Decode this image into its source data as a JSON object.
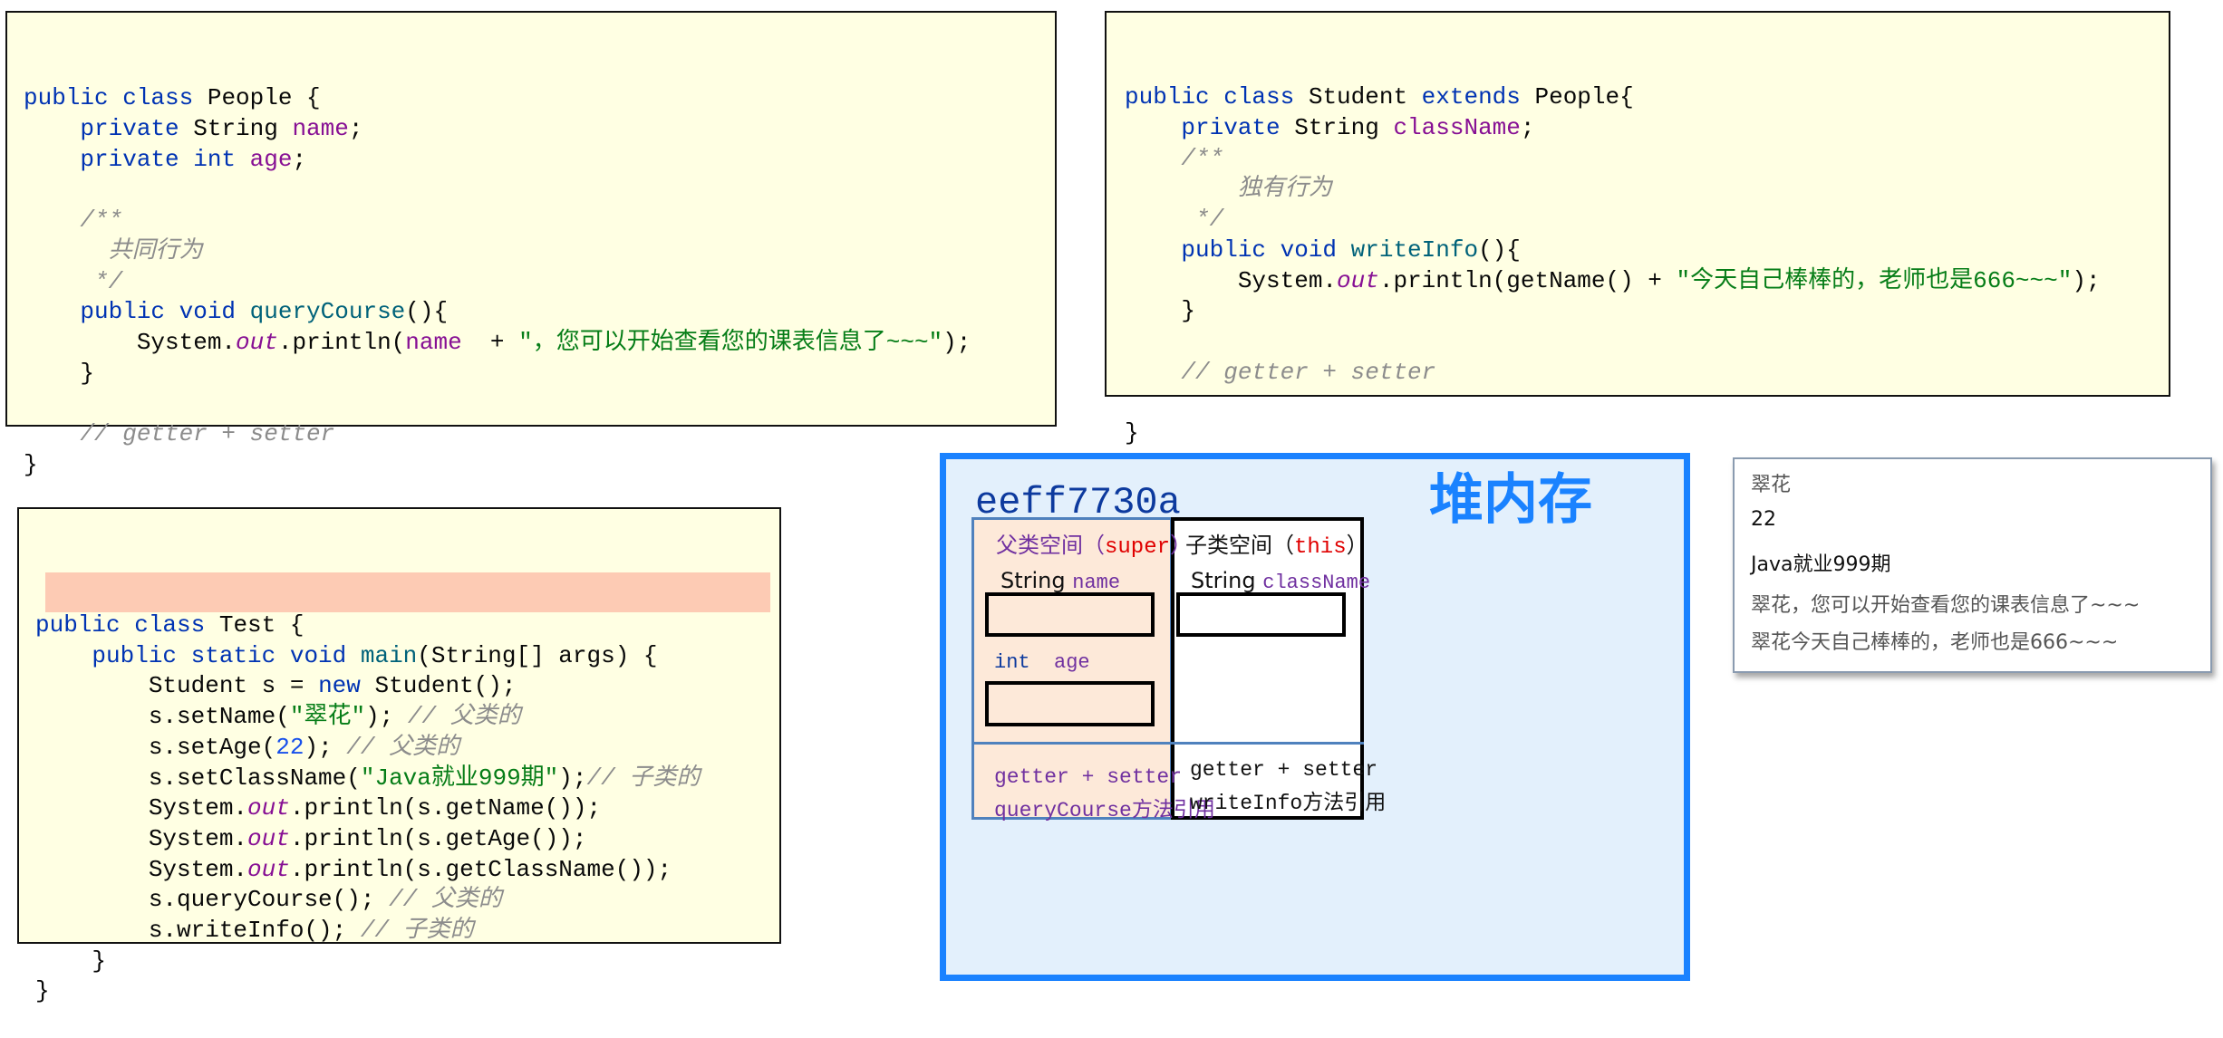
{
  "colors": {
    "code_bg": "#ffffe3",
    "keyword": "#0033b3",
    "method": "#00627a",
    "field": "#871094",
    "string": "#067d17",
    "comment": "#8c8c8c",
    "number": "#1750eb",
    "highlight": "#fdcbb4",
    "heap_border": "#1a82ff",
    "heap_bg": "#e3f0fc",
    "parent_space_bg": "#fde9d9",
    "parent_space_border": "#4f81bd"
  },
  "people_code": [
    [
      [
        "public class ",
        "kw"
      ],
      [
        "People {",
        ""
      ]
    ],
    [
      [
        "    private ",
        "kw"
      ],
      [
        "String ",
        ""
      ],
      [
        "name",
        "fld"
      ],
      [
        ";",
        ""
      ]
    ],
    [
      [
        "    private int ",
        "kw"
      ],
      [
        "age",
        "fld"
      ],
      [
        ";",
        ""
      ]
    ],
    [],
    [
      [
        "    /**",
        "cm"
      ]
    ],
    [
      [
        "      共同行为",
        "cm"
      ]
    ],
    [
      [
        "     */",
        "cm"
      ]
    ],
    [
      [
        "    public void ",
        "kw"
      ],
      [
        "queryCourse",
        "fn"
      ],
      [
        "(){",
        ""
      ]
    ],
    [
      [
        "        System.",
        ""
      ],
      [
        "out",
        "st"
      ],
      [
        ".println(",
        ""
      ],
      [
        "name",
        "fld"
      ],
      [
        "  + ",
        ""
      ],
      [
        "\"，您可以开始查看您的课表信息了~~~\"",
        "str"
      ],
      [
        ");",
        ""
      ]
    ],
    [
      [
        "    }",
        ""
      ]
    ],
    [],
    [
      [
        "    // getter + setter",
        "cm"
      ]
    ],
    [
      [
        "}",
        ""
      ]
    ]
  ],
  "student_code": [
    [
      [
        "public class ",
        "kw"
      ],
      [
        "Student ",
        ""
      ],
      [
        "extends ",
        "kw"
      ],
      [
        "People{",
        ""
      ]
    ],
    [
      [
        "    private ",
        "kw"
      ],
      [
        "String ",
        ""
      ],
      [
        "className",
        "fld"
      ],
      [
        ";",
        ""
      ]
    ],
    [
      [
        "    /**",
        "cm"
      ]
    ],
    [
      [
        "        独有行为",
        "cm"
      ]
    ],
    [
      [
        "     */",
        "cm"
      ]
    ],
    [
      [
        "    public void ",
        "kw"
      ],
      [
        "writeInfo",
        "fn"
      ],
      [
        "(){",
        ""
      ]
    ],
    [
      [
        "        System.",
        ""
      ],
      [
        "out",
        "st"
      ],
      [
        ".println(getName() + ",
        ""
      ],
      [
        "\"今天自己棒棒的，老师也是666~~~\"",
        "str"
      ],
      [
        ");",
        ""
      ]
    ],
    [
      [
        "    }",
        ""
      ]
    ],
    [],
    [
      [
        "    // getter + setter",
        "cm"
      ]
    ],
    [],
    [
      [
        "}",
        ""
      ]
    ]
  ],
  "test_code": [
    [
      [
        "public class ",
        "kw"
      ],
      [
        "Test {",
        ""
      ]
    ],
    [
      [
        "    public static void ",
        "kw"
      ],
      [
        "main",
        "fn"
      ],
      [
        "(String[] args) {",
        ""
      ]
    ],
    [
      [
        "        Student s = ",
        ""
      ],
      [
        "new ",
        "kw"
      ],
      [
        "Student();",
        ""
      ]
    ],
    [
      [
        "        s.setName(",
        ""
      ],
      [
        "\"翠花\"",
        "str"
      ],
      [
        "); ",
        ""
      ],
      [
        "// 父类的",
        "cm"
      ]
    ],
    [
      [
        "        s.setAge(",
        ""
      ],
      [
        "22",
        "num"
      ],
      [
        "); ",
        ""
      ],
      [
        "// 父类的",
        "cm"
      ]
    ],
    [
      [
        "        s.setClassName(",
        ""
      ],
      [
        "\"Java就业999期\"",
        "str"
      ],
      [
        ");",
        ""
      ],
      [
        "// 子类的",
        "cm"
      ]
    ],
    [
      [
        "        System.",
        ""
      ],
      [
        "out",
        "st"
      ],
      [
        ".println(s.getName());",
        ""
      ]
    ],
    [
      [
        "        System.",
        ""
      ],
      [
        "out",
        "st"
      ],
      [
        ".println(s.getAge());",
        ""
      ]
    ],
    [
      [
        "        System.",
        ""
      ],
      [
        "out",
        "st"
      ],
      [
        ".println(s.getClassName());",
        ""
      ]
    ],
    [
      [
        "        s.queryCourse(); ",
        ""
      ],
      [
        "// 父类的",
        "cm"
      ]
    ],
    [
      [
        "        s.writeInfo(); ",
        ""
      ],
      [
        "// 子类的",
        "cm"
      ]
    ],
    [
      [
        "    }",
        ""
      ]
    ],
    [
      [
        "}",
        ""
      ]
    ]
  ],
  "heap": {
    "title": "堆内存",
    "address": "eeff7730a",
    "parent": {
      "label": "父类空间（",
      "keyword": "super",
      "close": "）",
      "field1_type": "String ",
      "field1_name": "name",
      "field2_type": "int",
      "field2_name": "age",
      "methods1": "getter + setter",
      "methods2": "queryCourse方法引用"
    },
    "child": {
      "label": "子类空间（",
      "keyword": "this",
      "close": "）",
      "field1_type": "String ",
      "field1_name": "className",
      "methods1": "getter + setter",
      "methods2": "writeInfo方法引用"
    }
  },
  "output": [
    "翠花",
    "22",
    "Java就业999期",
    "翠花，您可以开始查看您的课表信息了~~~",
    "翠花今天自己棒棒的，老师也是666~~~"
  ]
}
